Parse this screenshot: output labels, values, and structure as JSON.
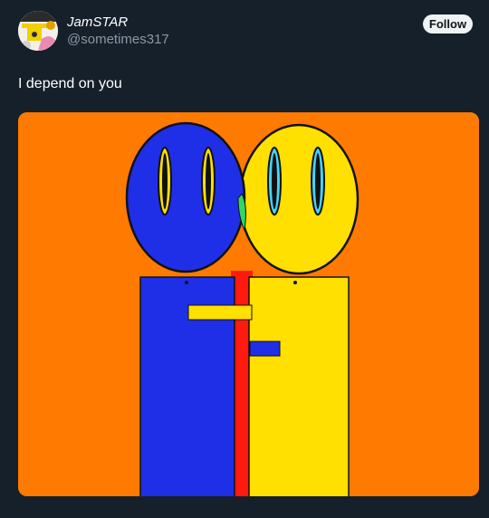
{
  "tweet": {
    "author": {
      "display_name": "JamSTAR",
      "handle": "@sometimes317",
      "avatar_icon": "avatar-image"
    },
    "follow_label": "Follow",
    "text": "I depend on you",
    "media": {
      "icon": "tweet-media-image",
      "colors": {
        "background": "#ff7a00",
        "blue": "#1f2fe8",
        "yellow": "#ffe000",
        "red": "#ff1a10",
        "green": "#35d660",
        "cyan": "#43d3ff"
      }
    }
  },
  "colors": {
    "background": "#15202b",
    "text": "#ffffff",
    "secondary_text": "#8b98a5",
    "button_bg": "#eff3f4",
    "button_text": "#0f1419"
  }
}
